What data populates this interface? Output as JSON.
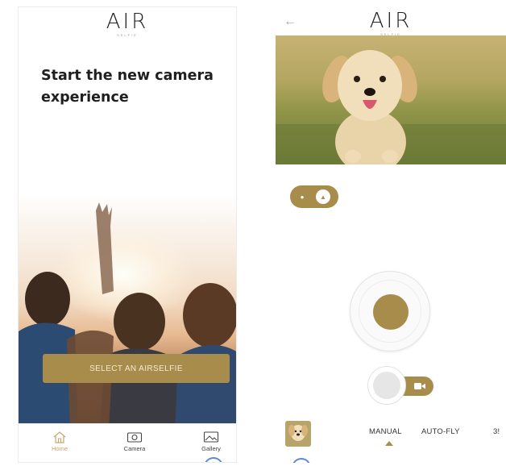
{
  "onboarding": {
    "logo_text": "AIR",
    "logo_subtext": "SELFIE",
    "title": "Start the new camera experience",
    "select_button_label": "SELECT AN AIRSELFIE",
    "nav": [
      {
        "label": "Home",
        "icon": "home-icon",
        "active": true
      },
      {
        "label": "Camera",
        "icon": "camera-icon",
        "active": false
      },
      {
        "label": "Gallery",
        "icon": "gallery-icon",
        "active": false
      }
    ]
  },
  "camera": {
    "logo_text": "AIR",
    "logo_subtext": "SELFIE",
    "back_icon": "back-arrow-icon",
    "modes": [
      "MANUAL",
      "AUTO-FLY",
      "3!"
    ],
    "selected_mode": "MANUAL"
  },
  "colors": {
    "accent": "#a88c4b",
    "nav_active": "#c9a46a"
  }
}
